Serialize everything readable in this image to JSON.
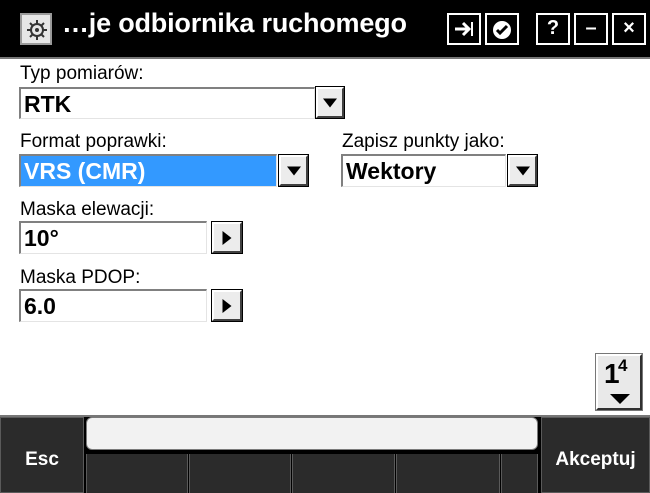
{
  "window": {
    "title": "…je odbiornika ruchomego",
    "app_icon": "settings-gear-icon",
    "buttons": {
      "forward_icon": "forward-arrow-icon",
      "ok_icon": "ok-check-icon",
      "help_label": "?",
      "minimize_label": "–",
      "close_label": "×"
    }
  },
  "form": {
    "survey_type": {
      "label": "Typ pomiarów:",
      "value": "RTK"
    },
    "correction_format": {
      "label": "Format poprawki:",
      "value": "VRS (CMR)"
    },
    "store_points_as": {
      "label": "Zapisz punkty jako:",
      "value": "Wektory"
    },
    "elevation_mask": {
      "label": "Maska elewacji:",
      "value": "10°"
    },
    "pdop_mask": {
      "label": "Maska PDOP:",
      "value": "6.0"
    }
  },
  "pager": {
    "current": "1",
    "total": "4"
  },
  "softkeys": {
    "esc_label": "Esc",
    "accept_label": "Akceptuj"
  },
  "colors": {
    "selection": "#3399ff",
    "bar_background": "#000000",
    "softkey_background": "#2b2b2b"
  }
}
